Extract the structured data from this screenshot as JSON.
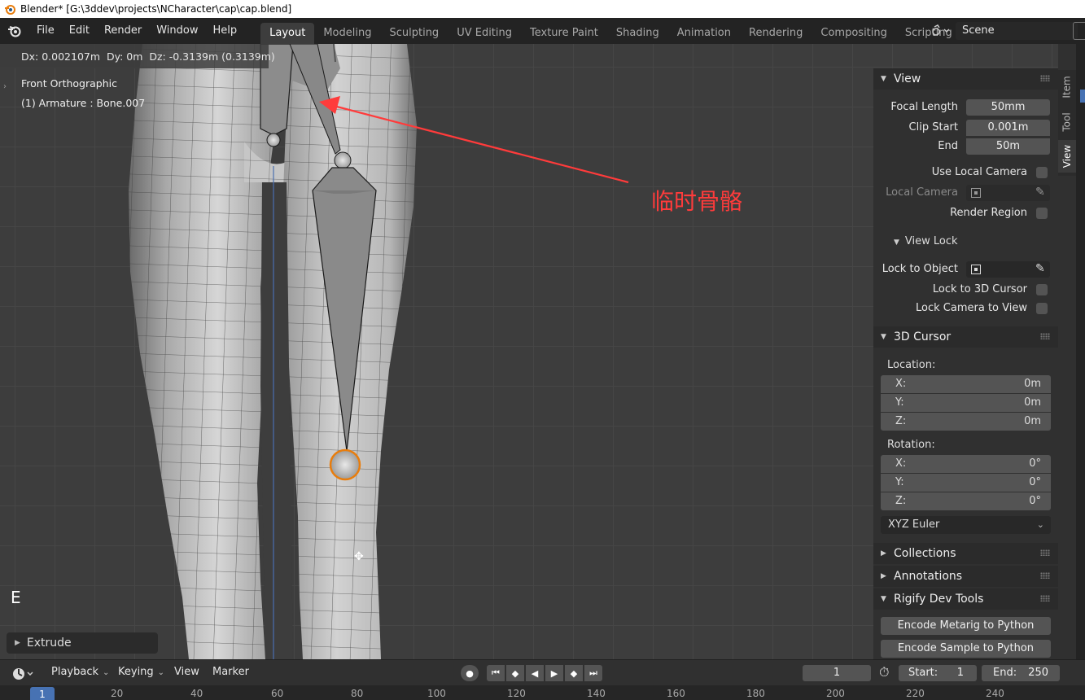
{
  "window": {
    "title": "Blender* [G:\\3ddev\\projects\\NCharacter\\cap\\cap.blend]"
  },
  "menu": [
    "File",
    "Edit",
    "Render",
    "Window",
    "Help"
  ],
  "workspaces": [
    "Layout",
    "Modeling",
    "Sculpting",
    "UV Editing",
    "Texture Paint",
    "Shading",
    "Animation",
    "Rendering",
    "Compositing",
    "Scripting"
  ],
  "active_workspace": "Layout",
  "scene": {
    "name": "Scene"
  },
  "viewport": {
    "delta": "Dx: 0.002107m  Dy: 0m  Dz: -0.3139m (0.3139m)",
    "view_name": "Front Orthographic",
    "object_info": "(1) Armature : Bone.007",
    "annotation": "临时骨骼",
    "key_hint": "E",
    "operator_panel": "Extrude"
  },
  "sidebar_tabs": [
    "Item",
    "Tool",
    "View"
  ],
  "active_sidebar_tab": "View",
  "npanel": {
    "view": {
      "title": "View",
      "focal_length_label": "Focal Length",
      "focal_length": "50mm",
      "clip_start_label": "Clip Start",
      "clip_start": "0.001m",
      "clip_end_label": "End",
      "clip_end": "50m",
      "use_local_camera_label": "Use Local Camera",
      "local_camera_label": "Local Camera",
      "render_region_label": "Render Region"
    },
    "view_lock": {
      "title": "View Lock",
      "lock_to_object_label": "Lock to Object",
      "lock_to_cursor_label": "Lock to 3D Cursor",
      "lock_camera_label": "Lock Camera to View"
    },
    "cursor": {
      "title": "3D Cursor",
      "location_label": "Location:",
      "location": [
        {
          "axis": "X:",
          "value": "0m"
        },
        {
          "axis": "Y:",
          "value": "0m"
        },
        {
          "axis": "Z:",
          "value": "0m"
        }
      ],
      "rotation_label": "Rotation:",
      "rotation": [
        {
          "axis": "X:",
          "value": "0°"
        },
        {
          "axis": "Y:",
          "value": "0°"
        },
        {
          "axis": "Z:",
          "value": "0°"
        }
      ],
      "rotation_mode": "XYZ Euler"
    },
    "collections": "Collections",
    "annotations": "Annotations",
    "rigify": {
      "title": "Rigify Dev Tools",
      "encode_metarig": "Encode Metarig to Python",
      "encode_sample": "Encode Sample to Python"
    }
  },
  "timeline": {
    "menus": [
      "Playback",
      "Keying",
      "View",
      "Marker"
    ],
    "current_frame": "1",
    "start_label": "Start:",
    "start": "1",
    "end_label": "End:",
    "end": "250",
    "ruler_ticks": [
      "20",
      "40",
      "60",
      "80",
      "100",
      "120",
      "140",
      "160",
      "180",
      "200",
      "220",
      "240"
    ],
    "ruler_current": "1"
  },
  "colors": {
    "accent": "#4772b3",
    "annotation_red": "#ff3b3b",
    "bone_select": "#e87d0d"
  }
}
